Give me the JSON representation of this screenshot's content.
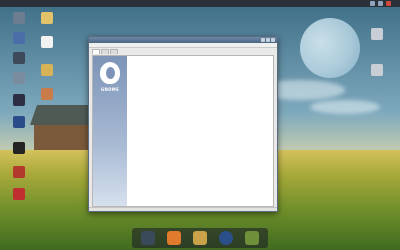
{
  "top_panel": {
    "menu_label": "",
    "clock": "",
    "tray": [
      "network-icon",
      "volume-icon",
      "power-icon"
    ]
  },
  "desktop_icons": [
    {
      "name": "folder-icon",
      "label": ""
    },
    {
      "name": "file-icon",
      "label": ""
    },
    {
      "name": "folder-icon",
      "label": ""
    },
    {
      "name": "trash-icon",
      "label": ""
    }
  ],
  "window": {
    "title": "",
    "menu": [
      "",
      "",
      "",
      ""
    ],
    "tabs": [
      {
        "label": ""
      },
      {
        "label": ""
      },
      {
        "label": ""
      }
    ],
    "sidebar_text": "GNOME",
    "content": {
      "heading": "",
      "lines": [
        "",
        ""
      ],
      "section1": "",
      "section1_lines": [
        "",
        ""
      ],
      "section2": "",
      "section2_lines": [
        ""
      ]
    }
  },
  "dock": {
    "items": [
      "terminal-icon",
      "firefox-icon",
      "files-icon",
      "media-icon",
      "system-monitor-icon"
    ]
  },
  "colors": {
    "sidebar_top": "#7d94b8",
    "titlebar": "#4b6584",
    "panel": "#2a2f38"
  }
}
